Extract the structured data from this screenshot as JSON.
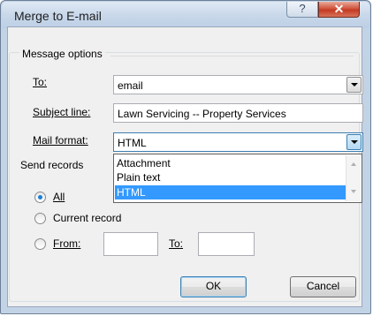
{
  "window": {
    "title": "Merge to E-mail",
    "help_glyph": "?",
    "close_glyph": "✕"
  },
  "message_options": {
    "legend": "Message options",
    "to_label": "To:",
    "to_value": "email",
    "subject_label": "Subject line:",
    "subject_value": "Lawn Servicing -- Property Services",
    "format_label": "Mail format:",
    "format_value": "HTML",
    "format_options": [
      "Attachment",
      "Plain text",
      "HTML"
    ],
    "format_selected_index": 2
  },
  "send_records": {
    "legend": "Send records",
    "all_label": "All",
    "current_label": "Current record",
    "from_label": "From:",
    "from_value": "",
    "to_label": "To:",
    "to_value": "",
    "selected": "all"
  },
  "buttons": {
    "ok": "OK",
    "cancel": "Cancel"
  },
  "colors": {
    "selection": "#3399ff",
    "window_frame": "#c3d3e6",
    "close_button": "#c43a23"
  },
  "icons": {
    "help": "help-icon",
    "close": "close-icon",
    "dropdown": "chevron-down-icon"
  }
}
